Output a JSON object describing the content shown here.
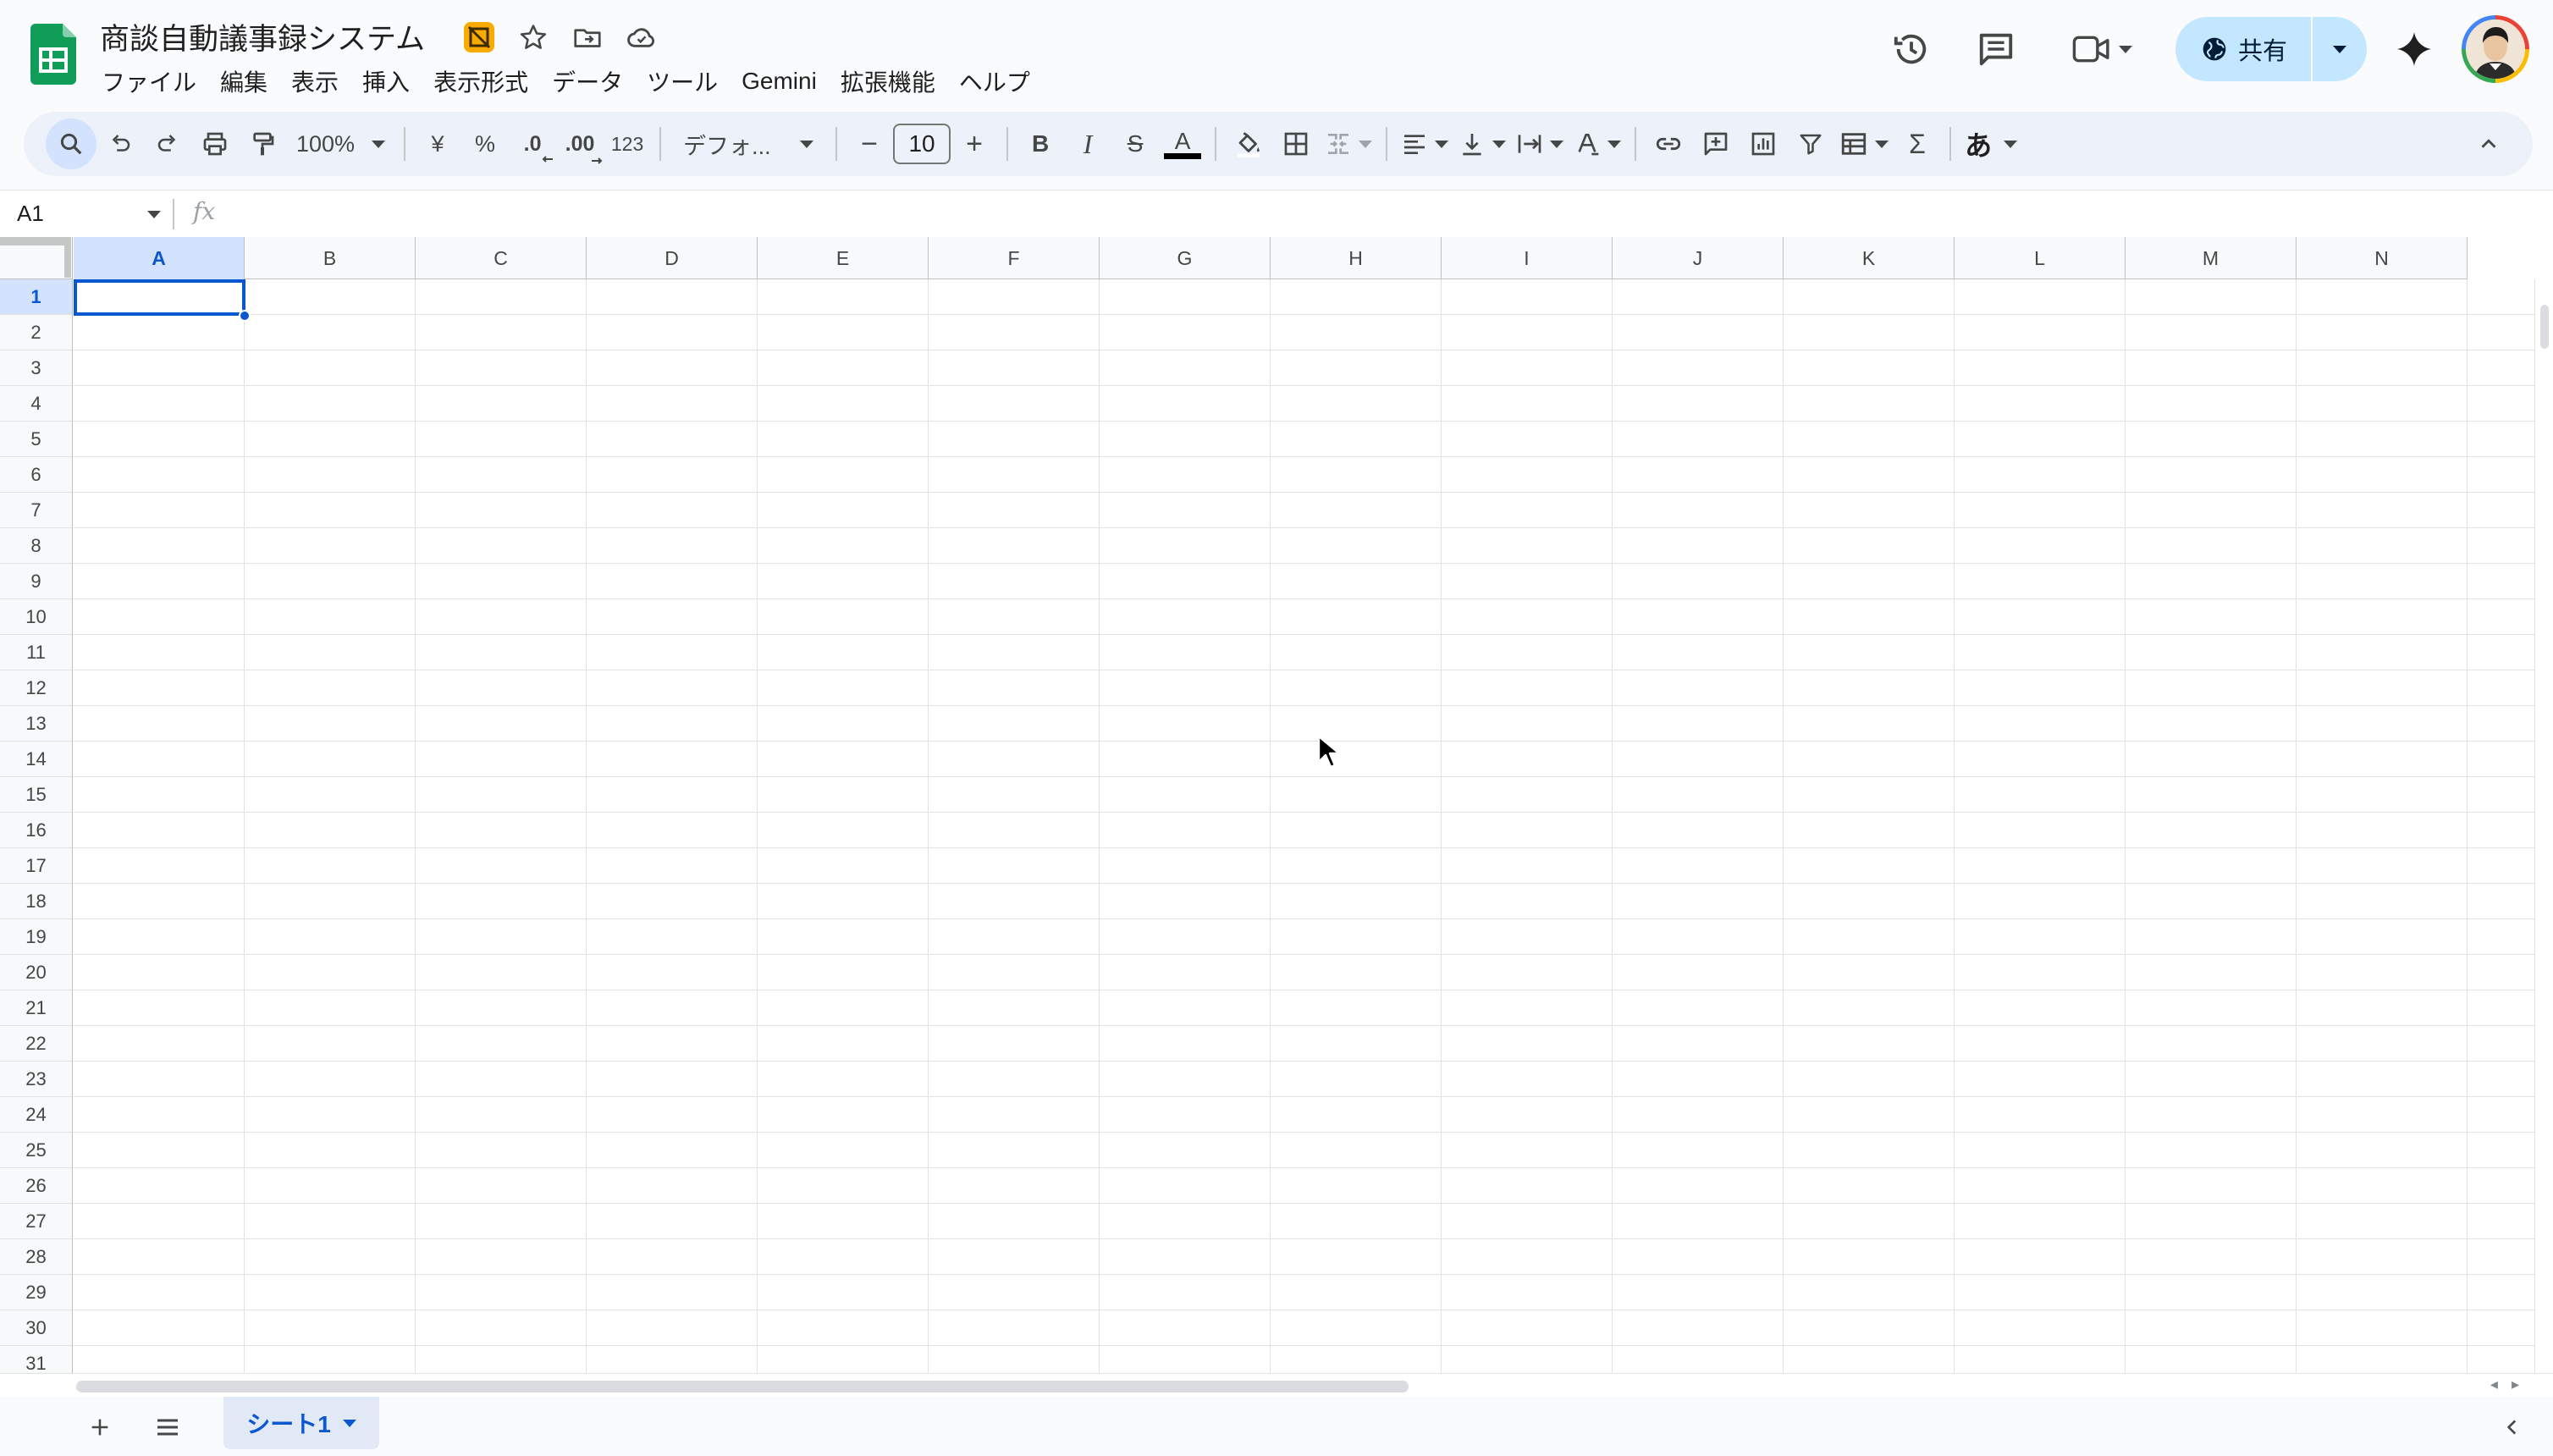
{
  "app": {
    "doc_title": "商談自動議事録システム",
    "menus": [
      "ファイル",
      "編集",
      "表示",
      "挿入",
      "表示形式",
      "データ",
      "ツール",
      "Gemini",
      "拡張機能",
      "ヘルプ"
    ],
    "share_label": "共有",
    "accent": "#0b57d0",
    "share_bg": "#c2e7ff"
  },
  "toolbar": {
    "zoom": "100%",
    "currency": "¥",
    "percent": "%",
    "dec_decrease": ".0",
    "dec_increase": ".00",
    "number_format": "123",
    "font": "デフォ...",
    "font_size": "10",
    "minus": "−",
    "plus": "+",
    "bold": "B",
    "italic": "I",
    "strike": "S",
    "text_color": "A",
    "input_tool": "あ",
    "sigma": "Σ"
  },
  "formula_bar": {
    "name_box": "A1",
    "fx": "fx",
    "value": ""
  },
  "grid": {
    "columns": [
      "A",
      "B",
      "C",
      "D",
      "E",
      "F",
      "G",
      "H",
      "I",
      "J",
      "K",
      "L",
      "M",
      "N"
    ],
    "rows": [
      "1",
      "2",
      "3",
      "4",
      "5",
      "6",
      "7",
      "8",
      "9",
      "10",
      "11",
      "12",
      "13",
      "14",
      "15",
      "16",
      "17",
      "18",
      "19",
      "20",
      "21",
      "22",
      "23",
      "24",
      "25",
      "26",
      "27",
      "28",
      "29",
      "30",
      "31"
    ],
    "selected_cell": "A1"
  },
  "sheets": {
    "tabs": [
      "シート1"
    ],
    "active": "シート1"
  }
}
